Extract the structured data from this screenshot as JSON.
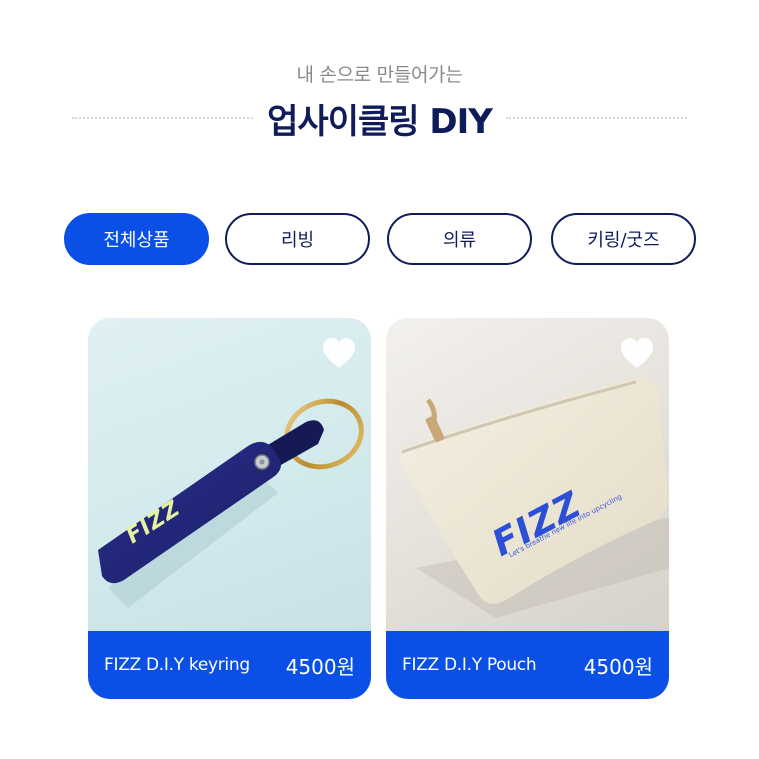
{
  "header": {
    "subtitle": "내 손으로 만들어가는",
    "title": "업사이클링 DIY"
  },
  "tabs": [
    {
      "label": "전체상품",
      "active": true
    },
    {
      "label": "리빙",
      "active": false
    },
    {
      "label": "의류",
      "active": false
    },
    {
      "label": "키링/굿즈",
      "active": false
    }
  ],
  "products": [
    {
      "name": "FIZZ D.I.Y keyring",
      "price": "4500원",
      "image_text": "FIZZ",
      "icon": "heart-icon"
    },
    {
      "name": "FIZZ D.I.Y Pouch",
      "price": "4500원",
      "image_text": "FIZZ",
      "image_subtext": "Let's breathe new life into upcycling",
      "icon": "heart-icon"
    }
  ],
  "colors": {
    "accent": "#0a4fe6",
    "navy": "#0f1c5a",
    "muted": "#8a8a8a"
  }
}
